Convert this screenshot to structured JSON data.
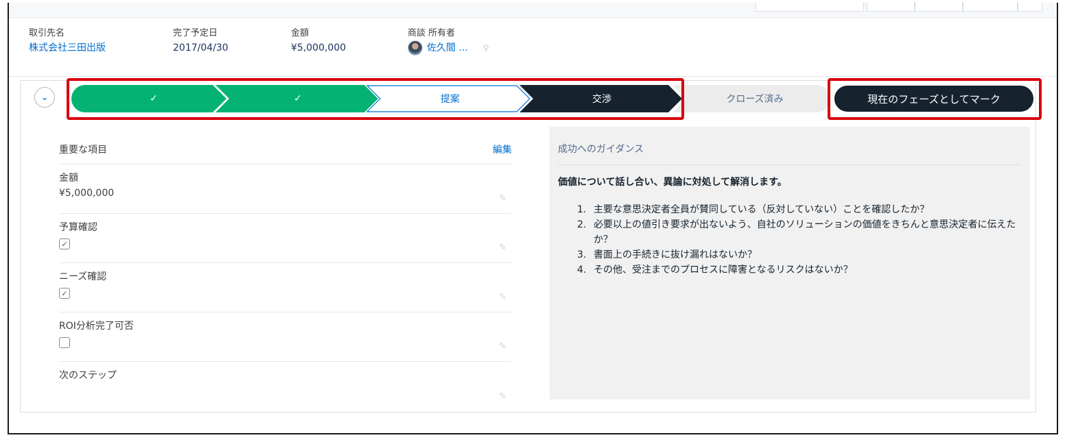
{
  "highlights": {
    "account": {
      "label": "取引先名",
      "value": "株式会社三田出版"
    },
    "close_date": {
      "label": "完了予定日",
      "value": "2017/04/30"
    },
    "amount": {
      "label": "金額",
      "value": "¥5,000,000"
    },
    "owner": {
      "label": "商談 所有者",
      "value": "佐久間 ..."
    }
  },
  "path": {
    "stages": [
      {
        "label": "✓",
        "status": "complete"
      },
      {
        "label": "✓",
        "status": "complete"
      },
      {
        "label": "提案",
        "status": "current"
      },
      {
        "label": "交渉",
        "status": "active"
      },
      {
        "label": "クローズ済み",
        "status": "upcoming"
      }
    ],
    "mark_button": "現在のフェーズとしてマーク",
    "toggle_icon": "chevron-down-icon"
  },
  "key_fields": {
    "title": "重要な項目",
    "edit": "編集",
    "fields": [
      {
        "label": "金額",
        "value": "¥5,000,000"
      },
      {
        "label": "予算確認",
        "checked": true
      },
      {
        "label": "ニーズ確認",
        "checked": true
      },
      {
        "label": "ROI分析完了可否",
        "checked": false
      },
      {
        "label": "次のステップ",
        "value": ""
      }
    ]
  },
  "guidance": {
    "title": "成功へのガイダンス",
    "lead": "価値について話し合い、異論に対処して解消します。",
    "items": [
      {
        "num": "1.",
        "text": "主要な意思決定者全員が賛同している（反対していない）ことを確認したか？"
      },
      {
        "num": "2.",
        "text": "必要以上の値引き要求が出ないよう、自社のソリューションの価値をきちんと意思決定者に伝えたか？"
      },
      {
        "num": "3.",
        "text": "書面上の手続きに抜け漏れはないか？"
      },
      {
        "num": "4.",
        "text": "その他、受注までのプロセスに障害となるリスクはないか？"
      }
    ]
  },
  "colors": {
    "complete": "#04b374",
    "active": "#16232f",
    "current_text": "#0070d2",
    "upcoming": "#ececec",
    "highlight_box": "#d8000d"
  }
}
